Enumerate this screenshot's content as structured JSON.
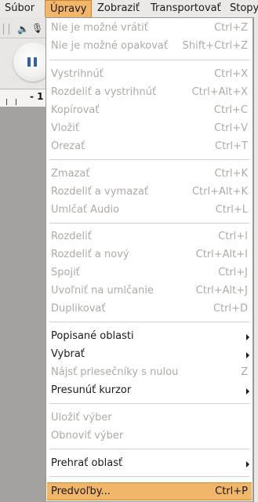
{
  "menubar": {
    "file": "Súbor",
    "edit": "Úpravy",
    "view": "Zobraziť",
    "transport": "Transportovať",
    "tracks": "Stopy"
  },
  "background": {
    "ruler_label": "- 1"
  },
  "menu": {
    "undo": {
      "label": "Nie je možné vrátiť",
      "accel": "Ctrl+Z"
    },
    "redo": {
      "label": "Nie je možné opakovať",
      "accel": "Shift+Ctrl+Z"
    },
    "cut": {
      "label": "Vystrihnúť",
      "accel": "Ctrl+X"
    },
    "split_cut": {
      "label": "Rozdeliť a vystrihnúť",
      "accel": "Ctrl+Alt+X"
    },
    "copy": {
      "label": "Kopírovať",
      "accel": "Ctrl+C"
    },
    "paste": {
      "label": "Vložiť",
      "accel": "Ctrl+V"
    },
    "trim": {
      "label": "Orezať",
      "accel": "Ctrl+T"
    },
    "delete": {
      "label": "Zmazať",
      "accel": "Ctrl+K"
    },
    "split_delete": {
      "label": "Rozdeliť a vymazať",
      "accel": "Ctrl+Alt+K"
    },
    "silence": {
      "label": "Umlčať Audio",
      "accel": "Ctrl+L"
    },
    "split": {
      "label": "Rozdeliť",
      "accel": "Ctrl+I"
    },
    "split_new": {
      "label": "Rozdeliť a nový",
      "accel": "Ctrl+Alt+I"
    },
    "join": {
      "label": "Spojiť",
      "accel": "Ctrl+J"
    },
    "detach": {
      "label": "Uvoľniť na umlčanie",
      "accel": "Ctrl+Alt+J"
    },
    "duplicate": {
      "label": "Duplikovať",
      "accel": "Ctrl+D"
    },
    "labeled_regions": {
      "label": "Popisané oblasti"
    },
    "select": {
      "label": "Vybrať"
    },
    "find_zero": {
      "label": "Nájsť priesečníky s nulou",
      "accel": "Z"
    },
    "move_cursor": {
      "label": "Presunúť kurzor"
    },
    "save_selection": {
      "label": "Uložiť výber"
    },
    "restore_selection": {
      "label": "Obnoviť výber"
    },
    "play_region": {
      "label": "Prehrať oblasť"
    },
    "preferences": {
      "label": "Predvoľby...",
      "accel": "Ctrl+P"
    }
  },
  "colors": {
    "highlight": "#f2b66a",
    "disabled_text": "#aeaba6",
    "text": "#1a1a1a"
  }
}
